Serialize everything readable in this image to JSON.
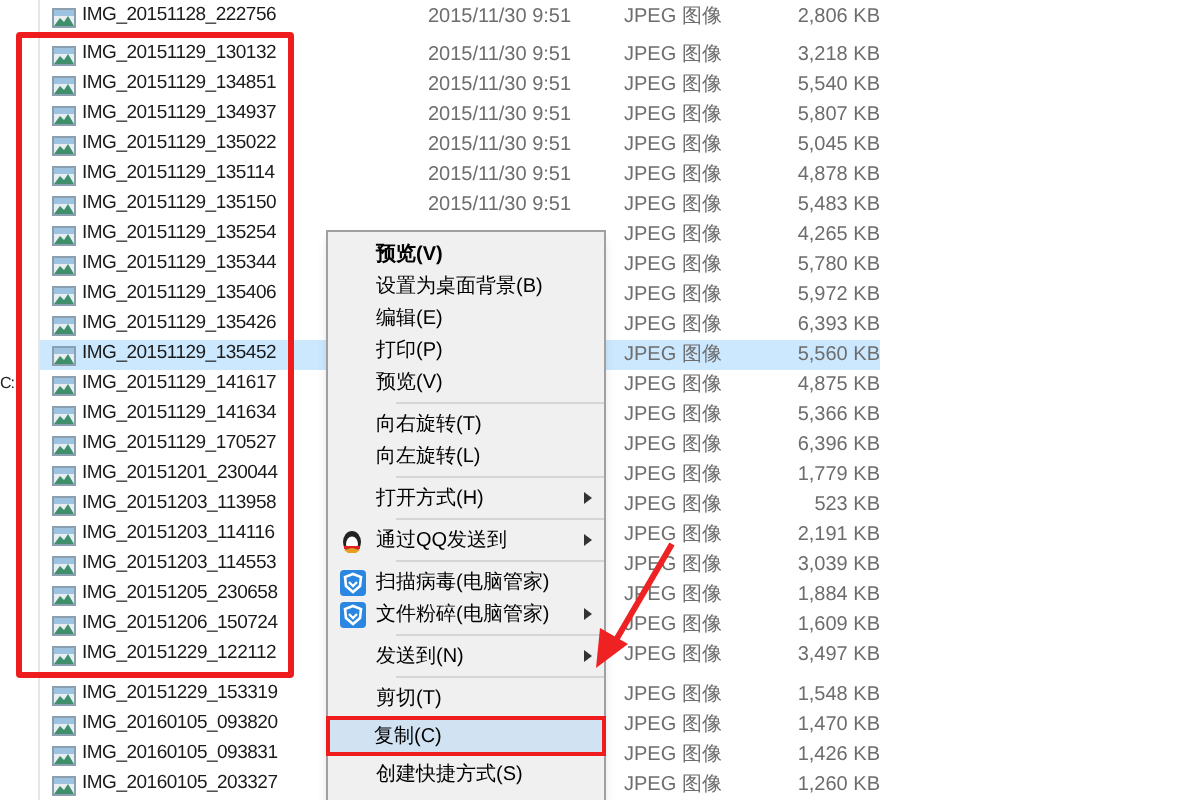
{
  "nav_pane": {
    "label": "C:"
  },
  "files": [
    {
      "name": "IMG_20151128_222756",
      "date": "2015/11/30 9:51",
      "type": "JPEG 图像",
      "size": "2,806 KB",
      "selected": false
    },
    {
      "name": "IMG_20151129_130132",
      "date": "2015/11/30 9:51",
      "type": "JPEG 图像",
      "size": "3,218 KB",
      "selected": false
    },
    {
      "name": "IMG_20151129_134851",
      "date": "2015/11/30 9:51",
      "type": "JPEG 图像",
      "size": "5,540 KB",
      "selected": false
    },
    {
      "name": "IMG_20151129_134937",
      "date": "2015/11/30 9:51",
      "type": "JPEG 图像",
      "size": "5,807 KB",
      "selected": false
    },
    {
      "name": "IMG_20151129_135022",
      "date": "2015/11/30 9:51",
      "type": "JPEG 图像",
      "size": "5,045 KB",
      "selected": false
    },
    {
      "name": "IMG_20151129_135114",
      "date": "2015/11/30 9:51",
      "type": "JPEG 图像",
      "size": "4,878 KB",
      "selected": false
    },
    {
      "name": "IMG_20151129_135150",
      "date": "2015/11/30 9:51",
      "type": "JPEG 图像",
      "size": "5,483 KB",
      "selected": false
    },
    {
      "name": "IMG_20151129_135254",
      "type": "JPEG 图像",
      "size": "4,265 KB",
      "selected": false
    },
    {
      "name": "IMG_20151129_135344",
      "type": "JPEG 图像",
      "size": "5,780 KB",
      "selected": false
    },
    {
      "name": "IMG_20151129_135406",
      "type": "JPEG 图像",
      "size": "5,972 KB",
      "selected": false
    },
    {
      "name": "IMG_20151129_135426",
      "type": "JPEG 图像",
      "size": "6,393 KB",
      "selected": false
    },
    {
      "name": "IMG_20151129_135452",
      "type": "JPEG 图像",
      "size": "5,560 KB",
      "selected": true
    },
    {
      "name": "IMG_20151129_141617",
      "type": "JPEG 图像",
      "size": "4,875 KB",
      "selected": false
    },
    {
      "name": "IMG_20151129_141634",
      "type": "JPEG 图像",
      "size": "5,366 KB",
      "selected": false
    },
    {
      "name": "IMG_20151129_170527",
      "type": "JPEG 图像",
      "size": "6,396 KB",
      "selected": false
    },
    {
      "name": "IMG_20151201_230044",
      "type": "JPEG 图像",
      "size": "1,779 KB",
      "selected": false
    },
    {
      "name": "IMG_20151203_113958",
      "type": "JPEG 图像",
      "size": "523 KB",
      "selected": false
    },
    {
      "name": "IMG_20151203_114116",
      "type": "JPEG 图像",
      "size": "2,191 KB",
      "selected": false
    },
    {
      "name": "IMG_20151203_114553",
      "type": "JPEG 图像",
      "size": "3,039 KB",
      "selected": false
    },
    {
      "name": "IMG_20151205_230658",
      "type": "JPEG 图像",
      "size": "1,884 KB",
      "selected": false
    },
    {
      "name": "IMG_20151206_150724",
      "type": "JPEG 图像",
      "size": "1,609 KB",
      "selected": false
    },
    {
      "name": "IMG_20151229_122112",
      "type": "JPEG 图像",
      "size": "3,497 KB",
      "selected": false
    },
    {
      "name": "IMG_20151229_153319",
      "type": "JPEG 图像",
      "size": "1,548 KB",
      "selected": false
    },
    {
      "name": "IMG_20160105_093820",
      "type": "JPEG 图像",
      "size": "1,470 KB",
      "selected": false
    },
    {
      "name": "IMG_20160105_093831",
      "type": "JPEG 图像",
      "size": "1,426 KB",
      "selected": false
    },
    {
      "name": "IMG_20160105_203327",
      "type": "JPEG 图像",
      "size": "1,260 KB",
      "selected": false
    }
  ],
  "context_menu": [
    {
      "kind": "item",
      "label": "预览(V)",
      "bold": true,
      "selected": false
    },
    {
      "kind": "item",
      "label": "设置为桌面背景(B)",
      "bold": false,
      "selected": false
    },
    {
      "kind": "item",
      "label": "编辑(E)",
      "bold": false,
      "selected": false
    },
    {
      "kind": "item",
      "label": "打印(P)",
      "bold": false,
      "selected": false
    },
    {
      "kind": "item",
      "label": "预览(V)",
      "bold": false,
      "selected": false
    },
    {
      "kind": "separator"
    },
    {
      "kind": "item",
      "label": "向右旋转(T)",
      "bold": false,
      "selected": false
    },
    {
      "kind": "item",
      "label": "向左旋转(L)",
      "bold": false,
      "selected": false
    },
    {
      "kind": "separator"
    },
    {
      "kind": "submenu",
      "label": "打开方式(H)",
      "bold": false,
      "selected": false
    },
    {
      "kind": "separator"
    },
    {
      "kind": "qq",
      "label": "通过QQ发送到",
      "bold": false,
      "selected": false
    },
    {
      "kind": "separator"
    },
    {
      "kind": "guard",
      "label": "扫描病毒(电脑管家)",
      "bold": false,
      "selected": false
    },
    {
      "kind": "guardsub",
      "label": "文件粉碎(电脑管家)",
      "bold": false,
      "selected": false
    },
    {
      "kind": "separator"
    },
    {
      "kind": "submenu",
      "label": "发送到(N)",
      "bold": false,
      "selected": false
    },
    {
      "kind": "separator"
    },
    {
      "kind": "item",
      "label": "剪切(T)",
      "bold": false,
      "selected": false
    },
    {
      "kind": "item",
      "label": "复制(C)",
      "bold": false,
      "selected": true
    },
    {
      "kind": "item",
      "label": "创建快捷方式(S)",
      "bold": false,
      "selected": false
    }
  ]
}
